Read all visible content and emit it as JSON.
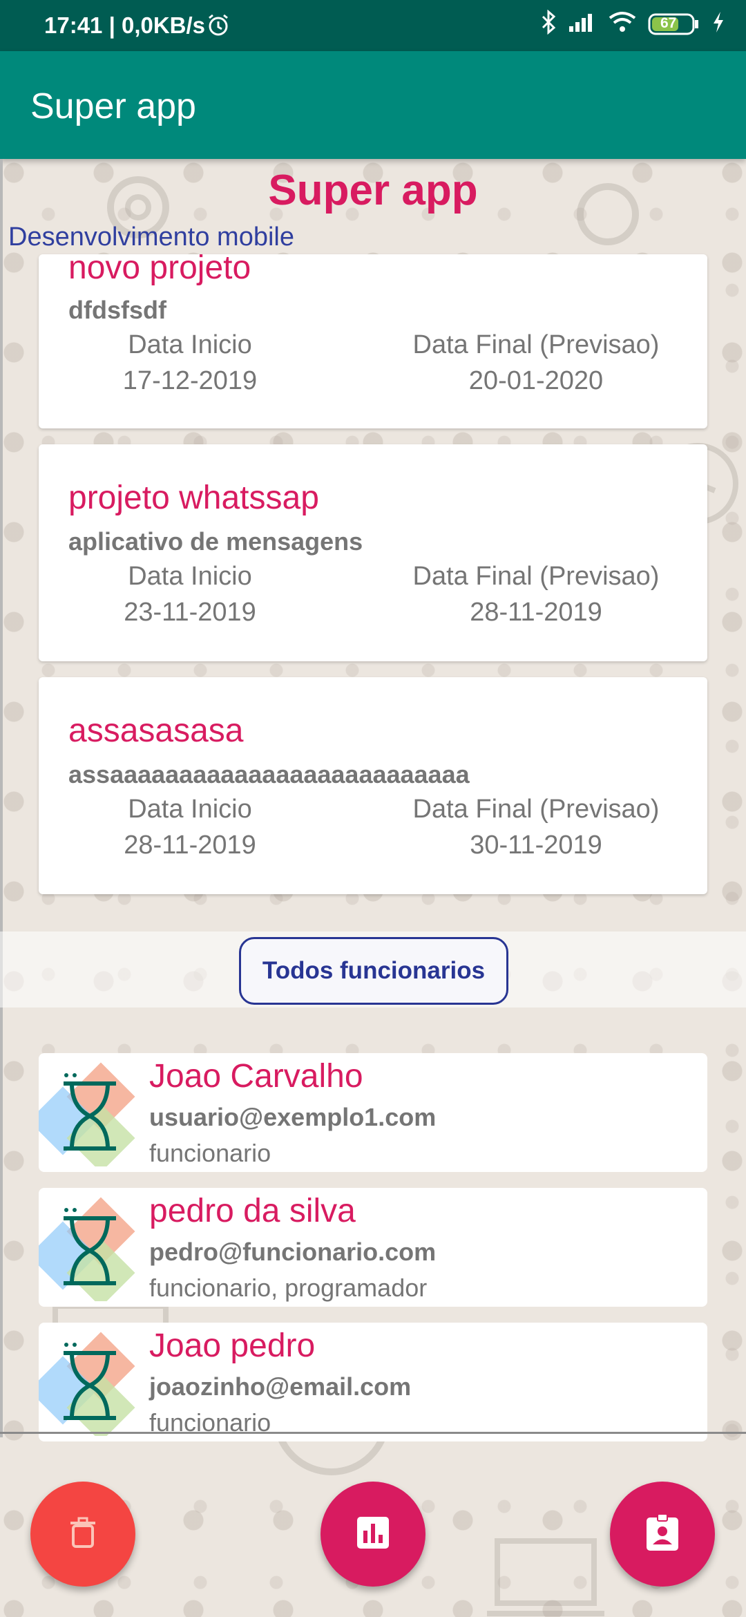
{
  "status_bar": {
    "time": "17:41 | 0,0KB/s",
    "battery": "67"
  },
  "app_bar": {
    "title": "Super app"
  },
  "header": {
    "title": "Super app",
    "subtitle": "Desenvolvimento mobile"
  },
  "projects": [
    {
      "name": "novo projeto",
      "description": "dfdsfsdf",
      "start_label": "Data Inicio",
      "start": "17-12-2019",
      "end_label": "Data Final (Previsao)",
      "end": "20-01-2020"
    },
    {
      "name": "projeto  whatssap",
      "description": "aplicativo de mensagens",
      "start_label": "Data Inicio",
      "start": "23-11-2019",
      "end_label": "Data Final (Previsao)",
      "end": "28-11-2019"
    },
    {
      "name": "assasasasa",
      "description": "assaaaaaaaaaaaaaaaaaaaaaaaaaa",
      "start_label": "Data Inicio",
      "start": "28-11-2019",
      "end_label": "Data Final (Previsao)",
      "end": "30-11-2019"
    }
  ],
  "all_employees_button": "Todos funcionarios",
  "employees": [
    {
      "name": "Joao Carvalho",
      "email": "usuario@exemplo1.com",
      "role": "funcionario"
    },
    {
      "name": "pedro da silva",
      "email": "pedro@funcionario.com",
      "role": "funcionario, programador"
    },
    {
      "name": "Joao pedro",
      "email": "joaozinho@email.com",
      "role": "funcionario"
    }
  ],
  "fabs": [
    {
      "icon": "trash-icon",
      "color": "#f44542"
    },
    {
      "icon": "bar-chart-icon",
      "color": "#d81b60"
    },
    {
      "icon": "contact-badge-icon",
      "color": "#d81b60"
    }
  ],
  "colors": {
    "accent": "#d81b60",
    "primary": "#00897b",
    "primary_dark": "#005c52",
    "indigo": "#283593"
  }
}
